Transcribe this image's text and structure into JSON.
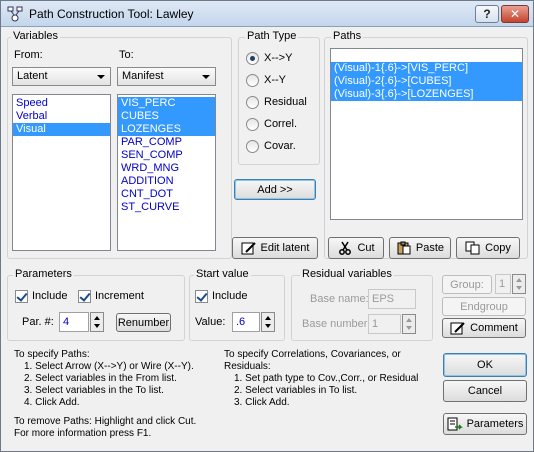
{
  "window": {
    "title": "Path Construction Tool: Lawley",
    "help_button": "?",
    "close_button": "✕"
  },
  "variables": {
    "group_label": "Variables",
    "from_label": "From:",
    "to_label": "To:",
    "from_select": "Latent",
    "to_select": "Manifest",
    "from_items": [
      "Speed",
      "Verbal",
      "Visual"
    ],
    "from_selected": [
      "Visual"
    ],
    "to_items": [
      "VIS_PERC",
      "CUBES",
      "LOZENGES",
      "PAR_COMP",
      "SEN_COMP",
      "WRD_MNG",
      "ADDITION",
      "CNT_DOT",
      "ST_CURVE"
    ],
    "to_selected": [
      "VIS_PERC",
      "CUBES",
      "LOZENGES"
    ]
  },
  "path_type": {
    "label": "Path Type",
    "options": [
      "X-->Y",
      "X--Y",
      "Residual",
      "Correl.",
      "Covar."
    ],
    "selected": "X-->Y"
  },
  "paths": {
    "label": "Paths",
    "items": [
      "(Visual)-1{.6}->[VIS_PERC]",
      "(Visual)-2{.6}->[CUBES]",
      "(Visual)-3{.6}->[LOZENGES]"
    ]
  },
  "buttons": {
    "add": "Add >>",
    "edit_latent": "Edit latent",
    "cut": "Cut",
    "paste": "Paste",
    "copy": "Copy",
    "renumber": "Renumber",
    "group": "Group:",
    "endgroup": "Endgroup",
    "comment": "Comment",
    "ok": "OK",
    "cancel": "Cancel",
    "parameters": "Parameters"
  },
  "parameters": {
    "label": "Parameters",
    "include_label": "Include",
    "include_checked": true,
    "increment_label": "Increment",
    "increment_checked": true,
    "par_label": "Par. #:",
    "par_value": "4"
  },
  "start_value": {
    "label": "Start value",
    "include_label": "Include",
    "include_checked": true,
    "value_label": "Value:",
    "value": ".6"
  },
  "residual": {
    "label": "Residual variables",
    "base_name_label": "Base name:",
    "base_name_value": "EPS",
    "base_number_label": "Base number:",
    "base_number_value": "1"
  },
  "group_value": "1",
  "help_left": {
    "lines": [
      "To specify Paths:",
      "1. Select Arrow (X-->Y) or Wire (X--Y).",
      "2. Select variables in the From list.",
      "3. Select variables in the To list.",
      "4. Click Add.",
      "",
      "To remove Paths: Highlight and click Cut.",
      "For more information press F1."
    ]
  },
  "help_right": {
    "lines": [
      "To specify Correlations, Covariances, or",
      "Residuals:",
      "1. Set path type to Cov.,Corr., or Residual",
      "2. Select variables in To list.",
      "3. Click Add."
    ]
  },
  "icons": {
    "app": "path-tool-app-icon",
    "edit": "pencil-icon",
    "cut": "scissors-icon",
    "paste": "clipboard-icon",
    "copy": "copy-pages-icon",
    "comment": "pencil-note-icon",
    "parameters": "parameters-arrow-icon"
  },
  "colors": {
    "selection": "#3399ff",
    "list_text": "#0000c8",
    "title_bar": "#c4d6ec"
  }
}
